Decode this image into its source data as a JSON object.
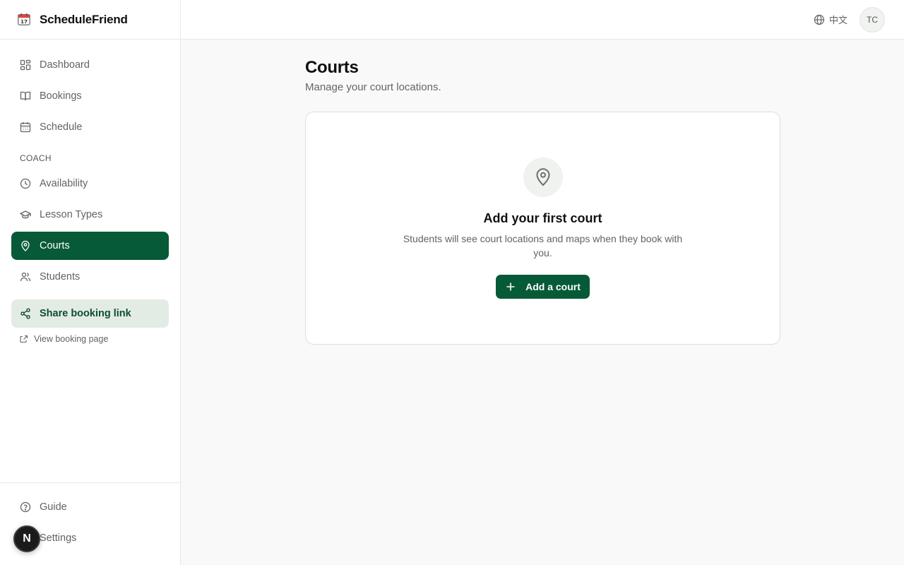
{
  "app": {
    "name": "ScheduleFriend",
    "icon": "calendar-emoji-icon"
  },
  "sidebar": {
    "items": [
      {
        "label": "Dashboard",
        "icon": "dashboard-grid-icon"
      },
      {
        "label": "Bookings",
        "icon": "book-open-icon"
      },
      {
        "label": "Schedule",
        "icon": "calendar-icon"
      }
    ],
    "section_label": "COACH",
    "coach_items": [
      {
        "label": "Availability",
        "icon": "clock-icon"
      },
      {
        "label": "Lesson Types",
        "icon": "graduation-cap-icon"
      },
      {
        "label": "Courts",
        "icon": "map-pin-icon",
        "active": true
      },
      {
        "label": "Students",
        "icon": "users-icon"
      }
    ],
    "share_label": "Share booking link",
    "view_label": "View booking page",
    "bottom_items": [
      {
        "label": "Guide",
        "icon": "help-circle-icon"
      },
      {
        "label": "Settings",
        "icon": "settings-icon"
      }
    ],
    "dev_badge": "N"
  },
  "topbar": {
    "language": "中文",
    "avatar_initials": "TC"
  },
  "main": {
    "title": "Courts",
    "subtitle": "Manage your court locations.",
    "empty_state": {
      "title": "Add your first court",
      "description": "Students will see court locations and maps when they book with you.",
      "button_label": "Add a court"
    }
  },
  "colors": {
    "accent": "#075a37",
    "accent_soft": "#e3ebe5",
    "background": "#f8f9f8"
  }
}
